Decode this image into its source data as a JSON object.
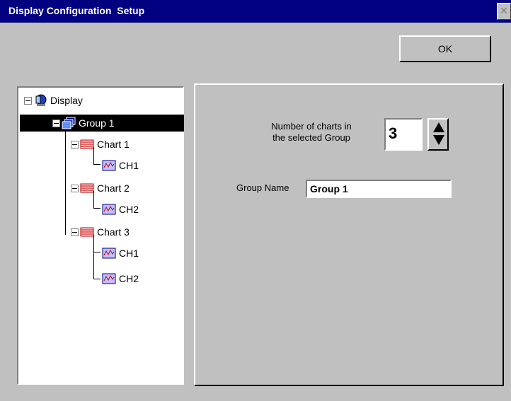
{
  "window": {
    "title": "Display Configuration  Setup",
    "close_glyph": "✕",
    "ok_label": "OK"
  },
  "tree": {
    "items": [
      {
        "label": "Display",
        "icon": "display-icon",
        "level": 0,
        "expander": true
      },
      {
        "label": "Group 1",
        "icon": "group-icon",
        "level": 1,
        "expander": true,
        "selected": true
      },
      {
        "label": "Chart 1",
        "icon": "chart-icon",
        "level": 2,
        "expander": true
      },
      {
        "label": "CH1",
        "icon": "channel-icon",
        "level": 3
      },
      {
        "label": "Chart 2",
        "icon": "chart-icon",
        "level": 2,
        "expander": true
      },
      {
        "label": "CH2",
        "icon": "channel-icon",
        "level": 3
      },
      {
        "label": "Chart 3",
        "icon": "chart-icon",
        "level": 2,
        "expander": true
      },
      {
        "label": "CH1",
        "icon": "channel-icon",
        "level": 3
      },
      {
        "label": "CH2",
        "icon": "channel-icon",
        "level": 3
      }
    ]
  },
  "panel": {
    "num_charts_label_line1": "Number of charts in",
    "num_charts_label_line2": "the selected Group",
    "num_charts_value": "3",
    "group_name_label": "Group Name",
    "group_name_value": "Group 1"
  },
  "colors": {
    "title_bar": "#000080",
    "face": "#c0c0c0",
    "selection": "#000000"
  }
}
